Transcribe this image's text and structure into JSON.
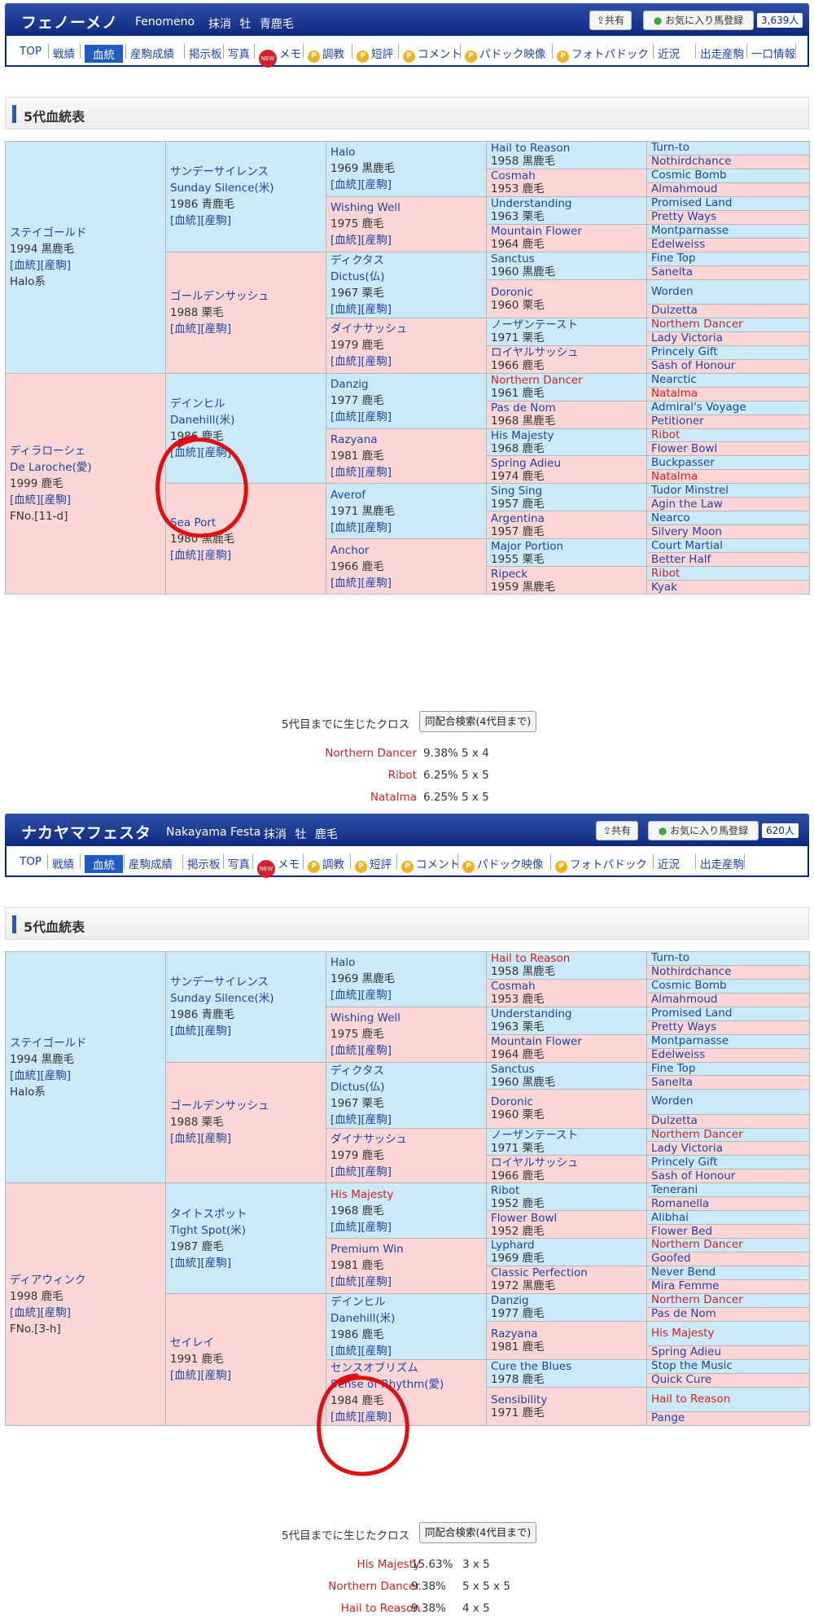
{
  "horses": [
    {
      "header": {
        "name_jp": "フェノーメノ",
        "name_en": "Fenomeno",
        "status": "抹消",
        "sex": "牡",
        "color": "青鹿毛",
        "share_label": "共有",
        "fav_label": "お気に入り馬登録",
        "fav_count": "3,639人"
      },
      "nav": [
        "TOP",
        "戦績",
        "血統",
        "産駒成績",
        "掲示板",
        "写真",
        "メモ",
        "調教",
        "短評",
        "コメント",
        "パドック映像",
        "フォトパドック",
        "近況",
        "出走産駒",
        "一口情報"
      ],
      "section_title": "5代血統表",
      "pedigree": {
        "g1": [
          {
            "name": "ステイゴールド",
            "info": "1994 黒鹿毛",
            "links": "[血統][産駒]",
            "extra": "Halo系"
          },
          {
            "name": "ディラローシェ",
            "name2": "De Laroche(愛)",
            "info": "1999 鹿毛",
            "links": "[血統][産駒]",
            "extra": "FNo.[11-d]"
          }
        ],
        "g2": [
          {
            "name": "サンデーサイレンス",
            "name2": "Sunday Silence(米)",
            "info": "1986 青鹿毛",
            "links": "[血統][産駒]"
          },
          {
            "name": "ゴールデンサッシュ",
            "info": "1988 栗毛",
            "links": "[血統][産駒]"
          },
          {
            "name": "デインヒル",
            "name2": "Danehill(米)",
            "info": "1986 鹿毛",
            "links": "[血統][産駒]"
          },
          {
            "name": "Sea Port",
            "info": "1980 黒鹿毛",
            "links": "[血統][産駒]"
          }
        ],
        "g3": [
          {
            "name": "Halo",
            "info": "1969 黒鹿毛",
            "links": "[血統][産駒]"
          },
          {
            "name": "Wishing Well",
            "info": "1975 鹿毛",
            "links": "[血統][産駒]"
          },
          {
            "name": "ディクタス",
            "name2": "Dictus(仏)",
            "info": "1967 栗毛",
            "links": "[血統][産駒]"
          },
          {
            "name": "ダイナサッシュ",
            "info": "1979 鹿毛",
            "links": "[血統][産駒]"
          },
          {
            "name": "Danzig",
            "info": "1977 鹿毛",
            "links": "[血統][産駒]"
          },
          {
            "name": "Razyana",
            "info": "1981 鹿毛",
            "links": "[血統][産駒]"
          },
          {
            "name": "Averof",
            "info": "1971 黒鹿毛",
            "links": "[血統][産駒]"
          },
          {
            "name": "Anchor",
            "info": "1966 鹿毛",
            "links": "[血統][産駒]"
          }
        ],
        "g4": [
          {
            "name": "Hail to Reason",
            "info": "1958 黒鹿毛"
          },
          {
            "name": "Cosmah",
            "info": "1953 鹿毛"
          },
          {
            "name": "Understanding",
            "info": "1963 栗毛"
          },
          {
            "name": "Mountain Flower",
            "info": "1964 鹿毛"
          },
          {
            "name": "Sanctus",
            "info": "1960 黒鹿毛"
          },
          {
            "name": "Doronic",
            "info": "1960 栗毛"
          },
          {
            "name": "ノーザンテースト",
            "info": "1971 栗毛"
          },
          {
            "name": "ロイヤルサッシュ",
            "info": "1966 鹿毛"
          },
          {
            "name": "Northern Dancer",
            "info": "1961 鹿毛",
            "red": true
          },
          {
            "name": "Pas de Nom",
            "info": "1968 黒鹿毛"
          },
          {
            "name": "His Majesty",
            "info": "1968 鹿毛"
          },
          {
            "name": "Spring Adieu",
            "info": "1974 鹿毛"
          },
          {
            "name": "Sing Sing",
            "info": "1957 鹿毛"
          },
          {
            "name": "Argentina",
            "info": "1957 鹿毛"
          },
          {
            "name": "Major Portion",
            "info": "1955 栗毛"
          },
          {
            "name": "Ripeck",
            "info": "1959 黒鹿毛"
          }
        ],
        "g5": [
          {
            "name": "Turn-to"
          },
          {
            "name": "Nothirdchance"
          },
          {
            "name": "Cosmic Bomb"
          },
          {
            "name": "Almahmoud"
          },
          {
            "name": "Promised Land"
          },
          {
            "name": "Pretty Ways"
          },
          {
            "name": "Montparnasse"
          },
          {
            "name": "Edelweiss"
          },
          {
            "name": "Fine Top"
          },
          {
            "name": "Sanelta"
          },
          {
            "name": "Worden"
          },
          {
            "name": "Dulzetta"
          },
          {
            "name": "Northern Dancer",
            "red": true
          },
          {
            "name": "Lady Victoria"
          },
          {
            "name": "Princely Gift"
          },
          {
            "name": "Sash of Honour"
          },
          {
            "name": "Nearctic"
          },
          {
            "name": "Natalma",
            "red": true
          },
          {
            "name": "Admiral's Voyage"
          },
          {
            "name": "Petitioner"
          },
          {
            "name": "Ribot",
            "red": true
          },
          {
            "name": "Flower Bowl"
          },
          {
            "name": "Buckpasser"
          },
          {
            "name": "Natalma",
            "red": true
          },
          {
            "name": "Tudor Minstrel"
          },
          {
            "name": "Agin the Law"
          },
          {
            "name": "Nearco"
          },
          {
            "name": "Silvery Moon"
          },
          {
            "name": "Court Martial"
          },
          {
            "name": "Better Half"
          },
          {
            "name": "Ribot",
            "red": true
          },
          {
            "name": "Kyak"
          }
        ]
      },
      "cross_label": "5代目までに生じたクロス",
      "search_btn": "同配合検索(4代目まで)",
      "crosses": [
        {
          "horse": "Northern Dancer",
          "pct": "9.38%",
          "gen": "5 x 4"
        },
        {
          "horse": "Ribot",
          "pct": "6.25%",
          "gen": "5 x 5"
        },
        {
          "horse": "Natalma",
          "pct": "6.25%",
          "gen": "5 x 5"
        }
      ]
    },
    {
      "header": {
        "name_jp": "ナカヤマフェスタ",
        "name_en": "Nakayama Festa",
        "status": "抹消",
        "sex": "牡",
        "color": "鹿毛",
        "share_label": "共有",
        "fav_label": "お気に入り馬登録",
        "fav_count": "620人"
      },
      "nav": [
        "TOP",
        "戦績",
        "血統",
        "産駒成績",
        "掲示板",
        "写真",
        "メモ",
        "調教",
        "短評",
        "コメント",
        "パドック映像",
        "フォトパドック",
        "近況",
        "出走産駒"
      ],
      "section_title": "5代血統表",
      "pedigree": {
        "g1": [
          {
            "name": "ステイゴールド",
            "info": "1994 黒鹿毛",
            "links": "[血統][産駒]",
            "extra": "Halo系"
          },
          {
            "name": "ディアウィンク",
            "info": "1998 鹿毛",
            "links": "[血統][産駒]",
            "extra": "FNo.[3-h]"
          }
        ],
        "g2": [
          {
            "name": "サンデーサイレンス",
            "name2": "Sunday Silence(米)",
            "info": "1986 青鹿毛",
            "links": "[血統][産駒]"
          },
          {
            "name": "ゴールデンサッシュ",
            "info": "1988 栗毛",
            "links": "[血統][産駒]"
          },
          {
            "name": "タイトスポット",
            "name2": "Tight Spot(米)",
            "info": "1987 鹿毛",
            "links": "[血統][産駒]"
          },
          {
            "name": "セイレイ",
            "info": "1991 鹿毛",
            "links": "[血統][産駒]"
          }
        ],
        "g3": [
          {
            "name": "Halo",
            "info": "1969 黒鹿毛",
            "links": "[血統][産駒]"
          },
          {
            "name": "Wishing Well",
            "info": "1975 鹿毛",
            "links": "[血統][産駒]"
          },
          {
            "name": "ディクタス",
            "name2": "Dictus(仏)",
            "info": "1967 栗毛",
            "links": "[血統][産駒]"
          },
          {
            "name": "ダイナサッシュ",
            "info": "1979 鹿毛",
            "links": "[血統][産駒]"
          },
          {
            "name": "His Majesty",
            "info": "1968 鹿毛",
            "links": "[血統][産駒]",
            "red": true
          },
          {
            "name": "Premium Win",
            "info": "1981 鹿毛",
            "links": "[血統][産駒]"
          },
          {
            "name": "デインヒル",
            "name2": "Danehill(米)",
            "info": "1986 鹿毛",
            "links": "[血統][産駒]"
          },
          {
            "name": "センスオブリズム",
            "name2": "Sense of Rhythm(愛)",
            "info": "1984 鹿毛",
            "links": "[血統][産駒]"
          }
        ],
        "g4": [
          {
            "name": "Hail to Reason",
            "info": "1958 黒鹿毛",
            "red": true
          },
          {
            "name": "Cosmah",
            "info": "1953 鹿毛"
          },
          {
            "name": "Understanding",
            "info": "1963 栗毛"
          },
          {
            "name": "Mountain Flower",
            "info": "1964 鹿毛"
          },
          {
            "name": "Sanctus",
            "info": "1960 黒鹿毛"
          },
          {
            "name": "Doronic",
            "info": "1960 栗毛"
          },
          {
            "name": "ノーザンテースト",
            "info": "1971 栗毛"
          },
          {
            "name": "ロイヤルサッシュ",
            "info": "1966 鹿毛"
          },
          {
            "name": "Ribot",
            "info": "1952 鹿毛"
          },
          {
            "name": "Flower Bowl",
            "info": "1952 鹿毛"
          },
          {
            "name": "Lyphard",
            "info": "1969 鹿毛"
          },
          {
            "name": "Classic Perfection",
            "info": "1972 黒鹿毛"
          },
          {
            "name": "Danzig",
            "info": "1977 鹿毛"
          },
          {
            "name": "Razyana",
            "info": "1981 鹿毛"
          },
          {
            "name": "Cure the Blues",
            "info": "1978 鹿毛"
          },
          {
            "name": "Sensibility",
            "info": "1971 鹿毛"
          }
        ],
        "g5": [
          {
            "name": "Turn-to"
          },
          {
            "name": "Nothirdchance"
          },
          {
            "name": "Cosmic Bomb"
          },
          {
            "name": "Almahmoud"
          },
          {
            "name": "Promised Land"
          },
          {
            "name": "Pretty Ways"
          },
          {
            "name": "Montparnasse"
          },
          {
            "name": "Edelweiss"
          },
          {
            "name": "Fine Top"
          },
          {
            "name": "Sanelta"
          },
          {
            "name": "Worden"
          },
          {
            "name": "Dulzetta"
          },
          {
            "name": "Northern Dancer",
            "red": true
          },
          {
            "name": "Lady Victoria"
          },
          {
            "name": "Princely Gift"
          },
          {
            "name": "Sash of Honour"
          },
          {
            "name": "Tenerani"
          },
          {
            "name": "Romanella"
          },
          {
            "name": "Alibhai"
          },
          {
            "name": "Flower Bed"
          },
          {
            "name": "Northern Dancer",
            "red": true
          },
          {
            "name": "Goofed"
          },
          {
            "name": "Never Bend"
          },
          {
            "name": "Mira Femme"
          },
          {
            "name": "Northern Dancer",
            "red": true
          },
          {
            "name": "Pas de Nom"
          },
          {
            "name": "His Majesty",
            "red": true
          },
          {
            "name": "Spring Adieu"
          },
          {
            "name": "Stop the Music"
          },
          {
            "name": "Quick Cure"
          },
          {
            "name": "Hail to Reason",
            "red": true
          },
          {
            "name": "Pange"
          }
        ]
      },
      "cross_label": "5代目までに生じたクロス",
      "search_btn": "同配合検索(4代目まで)",
      "crosses": [
        {
          "horse": "His Majesty",
          "pct": "15.63%",
          "gen": "3 x 5"
        },
        {
          "horse": "Northern Dancer",
          "pct": "9.38%",
          "gen": "5 x 5 x 5"
        },
        {
          "horse": "Hail to Reason",
          "pct": "9.38%",
          "gen": "4 x 5"
        }
      ]
    }
  ],
  "colors": {
    "male_bg": "#cbe9f8",
    "female_bg": "#fad6d6",
    "header_blue": "#0d2a80",
    "link_blue": "#1d44a8",
    "cross_red": "#d62020",
    "annotation_red": "#e01010"
  }
}
